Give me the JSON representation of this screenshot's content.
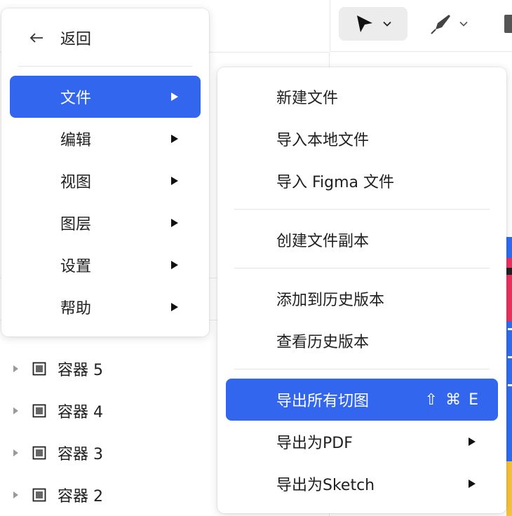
{
  "toolbar": {
    "tools": [
      {
        "icon": "move-pointer-icon",
        "active": true
      },
      {
        "icon": "pen-tool-icon",
        "active": false
      },
      {
        "icon": "rectangle-tool-icon",
        "active": false
      }
    ]
  },
  "layers": [
    {
      "name": "容器 5",
      "icon": "frame-icon"
    },
    {
      "name": "容器 4",
      "icon": "frame-icon"
    },
    {
      "name": "容器 3",
      "icon": "frame-icon"
    },
    {
      "name": "容器 2",
      "icon": "frame-icon"
    }
  ],
  "main_menu": {
    "back_label": "返回",
    "items": [
      {
        "label": "文件",
        "has_submenu": true,
        "active": true
      },
      {
        "label": "编辑",
        "has_submenu": true
      },
      {
        "label": "视图",
        "has_submenu": true
      },
      {
        "label": "图层",
        "has_submenu": true
      },
      {
        "label": "设置",
        "has_submenu": true
      },
      {
        "label": "帮助",
        "has_submenu": true
      }
    ]
  },
  "file_menu": {
    "items": [
      {
        "label": "新建文件"
      },
      {
        "label": "导入本地文件"
      },
      {
        "label": "导入 Figma 文件"
      },
      {
        "label": "创建文件副本"
      },
      {
        "label": "添加到历史版本"
      },
      {
        "label": "查看历史版本"
      },
      {
        "label": "导出所有切图",
        "shortcut": "⇧ ⌘ E",
        "active": true
      },
      {
        "label": "导出为PDF",
        "has_submenu": true
      },
      {
        "label": "导出为Sketch",
        "has_submenu": true
      }
    ]
  },
  "colors": {
    "accent": "#3366ee",
    "canvas_blue": "#2f6df5",
    "canvas_pink": "#f0305e",
    "canvas_yellow": "#f7c33a"
  }
}
